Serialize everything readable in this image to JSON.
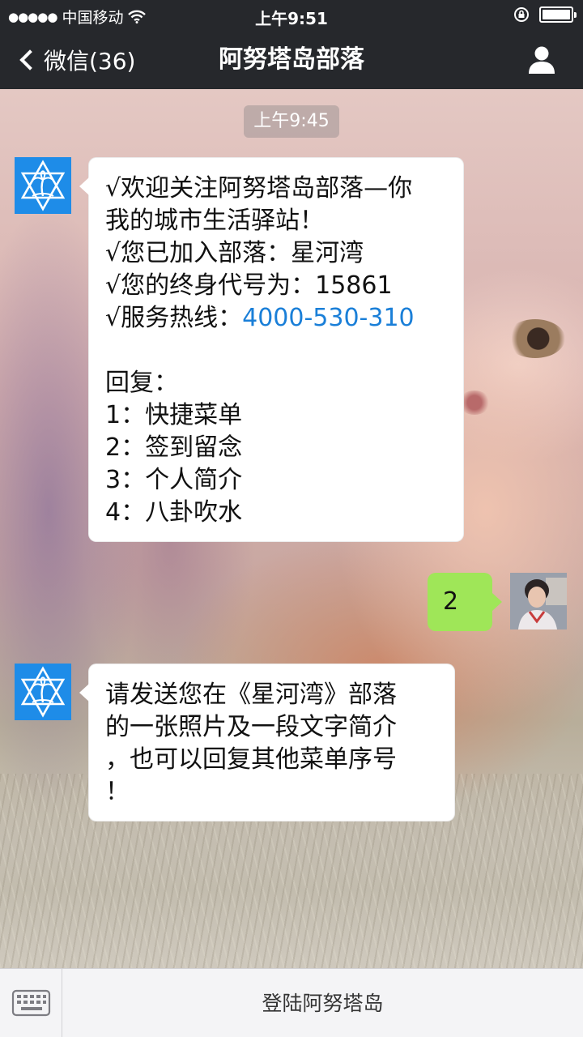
{
  "status_bar": {
    "signal": "●●●●●",
    "carrier": "中国移动",
    "time": "上午9:51"
  },
  "nav": {
    "back_label": "微信(36)",
    "title": "阿努塔岛部落"
  },
  "chat": {
    "timestamp": "上午9:45",
    "message1": {
      "lines": [
        "√欢迎关注阿努塔岛部落—你",
        "我的城市生活驿站！",
        "√您已加入部落：星河湾",
        "√您的终身代号为：15861"
      ],
      "hotline_label": "√服务热线：",
      "hotline_number": "4000-530-310",
      "reply_label": "回复：",
      "options": [
        "1：快捷菜单",
        "2：签到留念",
        "3：个人简介",
        "4：八卦吹水"
      ]
    },
    "user_message": "2",
    "message2": {
      "lines": [
        "请发送您在《星河湾》部落",
        "的一张照片及一段文字简介",
        "，也可以回复其他菜单序号",
        "！"
      ]
    }
  },
  "bottom_bar": {
    "menu_label": "登陆阿努塔岛"
  },
  "icons": {
    "back": "chevron-left-icon",
    "profile": "person-icon",
    "keyboard": "keyboard-icon",
    "wifi": "wifi-icon",
    "lock": "rotation-lock-icon",
    "battery": "battery-icon",
    "logo": "star-palm-logo"
  },
  "colors": {
    "topbar": "#26282c",
    "logo_blue": "#1e8ce8",
    "sent_bubble": "#9fe658",
    "link": "#1a7fd8"
  }
}
